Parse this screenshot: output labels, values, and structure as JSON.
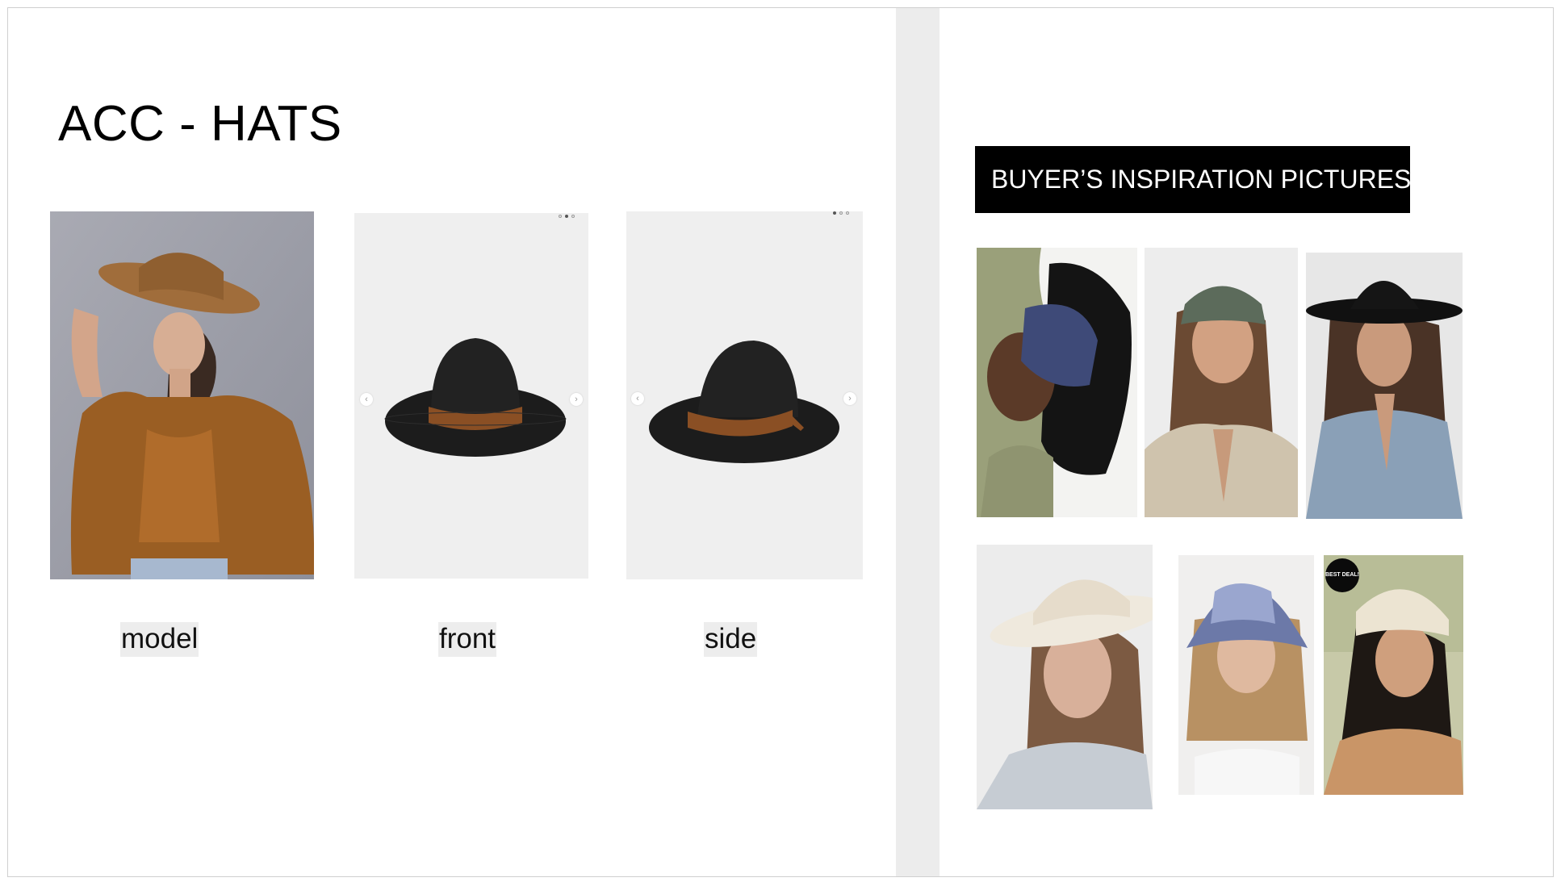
{
  "slide": {
    "title": "ACC - HATS"
  },
  "product_views": [
    {
      "caption": "model",
      "image": "woman-in-brown-wide-brim-hat-photo"
    },
    {
      "caption": "front",
      "image": "black-fedora-front-photo"
    },
    {
      "caption": "side",
      "image": "black-fedora-side-photo"
    }
  ],
  "inspiration": {
    "banner": "BUYER’S INSPIRATION PICTURES",
    "images": [
      "woman-navy-baseball-cap-photo",
      "woman-green-baseball-cap-photo",
      "woman-black-wide-brim-hat-photo",
      "woman-straw-sun-hat-photo",
      "woman-tie-dye-bucket-hat-photo",
      "woman-cream-bucket-hat-photo"
    ],
    "sticker_text": "BEST DEAL!"
  },
  "colors": {
    "banner_bg": "#000000",
    "banner_text": "#ffffff",
    "gutter": "#ececec",
    "caption_bg": "#ededed"
  }
}
